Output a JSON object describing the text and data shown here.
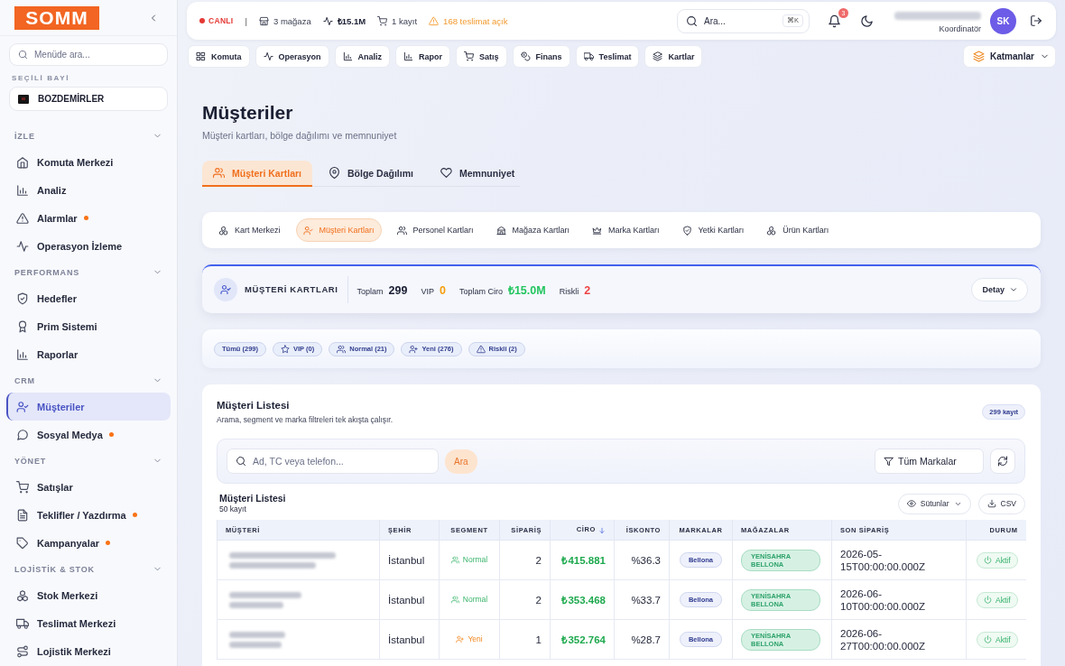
{
  "sidebar": {
    "logo": "SOMM",
    "search": {
      "placeholder": "Menüde ara..."
    },
    "dealer_label": "SEÇİLİ BAYİ",
    "dealer": "BOZDEMİRLER",
    "sections": [
      {
        "title": "İZLE",
        "expanded": true,
        "items": [
          {
            "label": "Komuta Merkezi",
            "selected": false,
            "alert": false
          },
          {
            "label": "Analiz",
            "selected": false,
            "alert": false
          },
          {
            "label": "Alarmlar",
            "selected": false,
            "alert": true
          },
          {
            "label": "Operasyon İzleme",
            "selected": false,
            "alert": false
          }
        ]
      },
      {
        "title": "PERFORMANS",
        "expanded": true,
        "items": [
          {
            "label": "Hedefler",
            "selected": false,
            "alert": false
          },
          {
            "label": "Prim Sistemi",
            "selected": false,
            "alert": false
          },
          {
            "label": "Raporlar",
            "selected": false,
            "alert": false
          }
        ]
      },
      {
        "title": "CRM",
        "expanded": true,
        "items": [
          {
            "label": "Müşteriler",
            "selected": true,
            "alert": false
          },
          {
            "label": "Sosyal Medya",
            "selected": false,
            "alert": true
          }
        ]
      },
      {
        "title": "YÖNET",
        "expanded": true,
        "items": [
          {
            "label": "Satışlar",
            "selected": false,
            "alert": false
          },
          {
            "label": "Teklifler / Yazdırma",
            "selected": false,
            "alert": true
          },
          {
            "label": "Kampanyalar",
            "selected": false,
            "alert": true
          }
        ]
      },
      {
        "title": "LOJİSTİK & STOK",
        "expanded": true,
        "items": [
          {
            "label": "Stok Merkezi",
            "selected": false,
            "alert": false
          },
          {
            "label": "Teslimat Merkezi",
            "selected": false,
            "alert": false
          },
          {
            "label": "Lojistik Merkezi",
            "selected": false,
            "alert": false
          }
        ]
      }
    ]
  },
  "topbar": {
    "status": "CANLI",
    "separator": "|",
    "stats": [
      {
        "text": "3 mağaza",
        "kind": "plain"
      },
      {
        "text": "₺15.1M",
        "kind": "bold"
      },
      {
        "text": "1 kayıt",
        "kind": "plain"
      },
      {
        "text": "168 teslimat açık",
        "kind": "warning"
      }
    ],
    "search": {
      "placeholder": "Ara...",
      "shortcut": "⌘K"
    },
    "notification_count": "3",
    "user_role": "Koordinatör",
    "avatar_initials": "SK"
  },
  "nav": {
    "items": [
      {
        "label": "Komuta"
      },
      {
        "label": "Operasyon"
      },
      {
        "label": "Analiz"
      },
      {
        "label": "Rapor"
      },
      {
        "label": "Satış"
      },
      {
        "label": "Finans"
      },
      {
        "label": "Teslimat"
      },
      {
        "label": "Kartlar"
      }
    ],
    "layers": "Katmanlar"
  },
  "page": {
    "title": "Müşteriler",
    "subtitle": "Müşteri kartları, bölge dağılımı ve memnuniyet"
  },
  "tabs": [
    {
      "label": "Müşteri Kartları",
      "selected": true
    },
    {
      "label": "Bölge Dağılımı",
      "selected": false
    },
    {
      "label": "Memnuniyet",
      "selected": false
    }
  ],
  "card_tabs": [
    {
      "label": "Kart Merkezi",
      "selected": false
    },
    {
      "label": "Müşteri Kartları",
      "selected": true
    },
    {
      "label": "Personel Kartları",
      "selected": false
    },
    {
      "label": "Mağaza Kartları",
      "selected": false
    },
    {
      "label": "Marka Kartları",
      "selected": false
    },
    {
      "label": "Yetki Kartları",
      "selected": false
    },
    {
      "label": "Ürün Kartları",
      "selected": false
    }
  ],
  "summary": {
    "title": "MÜŞTERİ KARTLARI",
    "stats": [
      {
        "label": "Toplam",
        "value": "299",
        "color": "#1b1f33"
      },
      {
        "label": "VIP",
        "value": "0",
        "color": "#f59e0b"
      },
      {
        "label": "Toplam Ciro",
        "value": "₺15.0M",
        "color": "#22c55e"
      },
      {
        "label": "Riskli",
        "value": "2",
        "color": "#ef4444"
      }
    ],
    "detail_button": "Detay"
  },
  "filters": [
    {
      "label": "Tümü (299)"
    },
    {
      "label": "VIP (0)"
    },
    {
      "label": "Normal (21)"
    },
    {
      "label": "Yeni (276)"
    },
    {
      "label": "Riskli (2)"
    }
  ],
  "list": {
    "title": "Müşteri Listesi",
    "subtitle": "Arama, segment ve marka filtreleri tek akışta çalışır.",
    "count": "299 kayıt",
    "search": {
      "placeholder": "Ad, TC veya telefon..."
    },
    "search_button": "Ara",
    "brand_select": "Tüm Markalar",
    "table_title": "Müşteri Listesi",
    "table_count": "50 kayıt",
    "columns_button": "Sütunlar",
    "csv_button": "CSV",
    "columns": [
      {
        "label": "MÜŞTERİ",
        "sorted": false
      },
      {
        "label": "ŞEHİR",
        "sorted": false
      },
      {
        "label": "SEGMENT",
        "sorted": false
      },
      {
        "label": "SİPARİŞ",
        "sorted": false
      },
      {
        "label": "CİRO",
        "sorted": true
      },
      {
        "label": "İSKONTO",
        "sorted": false
      },
      {
        "label": "MARKALAR",
        "sorted": false
      },
      {
        "label": "MAĞAZALAR",
        "sorted": false
      },
      {
        "label": "SON SİPARİŞ",
        "sorted": false
      },
      {
        "label": "DURUM",
        "sorted": false
      }
    ],
    "rows": [
      {
        "city": "İstanbul",
        "segment": {
          "label": "Normal",
          "kind": "normal"
        },
        "orders": "2",
        "revenue": "₺415.881",
        "discount": "%36.3",
        "brand": "Bellona",
        "stores": "YENİSAHRA BELLONA",
        "last_order": "2026-05-15T00:00:00.000Z",
        "status": {
          "label": "Aktif",
          "kind": "active"
        }
      },
      {
        "city": "İstanbul",
        "segment": {
          "label": "Normal",
          "kind": "normal"
        },
        "orders": "2",
        "revenue": "₺353.468",
        "discount": "%33.7",
        "brand": "Bellona",
        "stores": "YENİSAHRA BELLONA",
        "last_order": "2026-06-10T00:00:00.000Z",
        "status": {
          "label": "Aktif",
          "kind": "active"
        }
      },
      {
        "city": "İstanbul",
        "segment": {
          "label": "Yeni",
          "kind": "new"
        },
        "orders": "1",
        "revenue": "₺352.764",
        "discount": "%28.7",
        "brand": "Bellona",
        "stores": "YENİSAHRA BELLONA",
        "last_order": "2026-06-27T00:00:00.000Z",
        "status": {
          "label": "Aktif",
          "kind": "active"
        }
      }
    ]
  }
}
